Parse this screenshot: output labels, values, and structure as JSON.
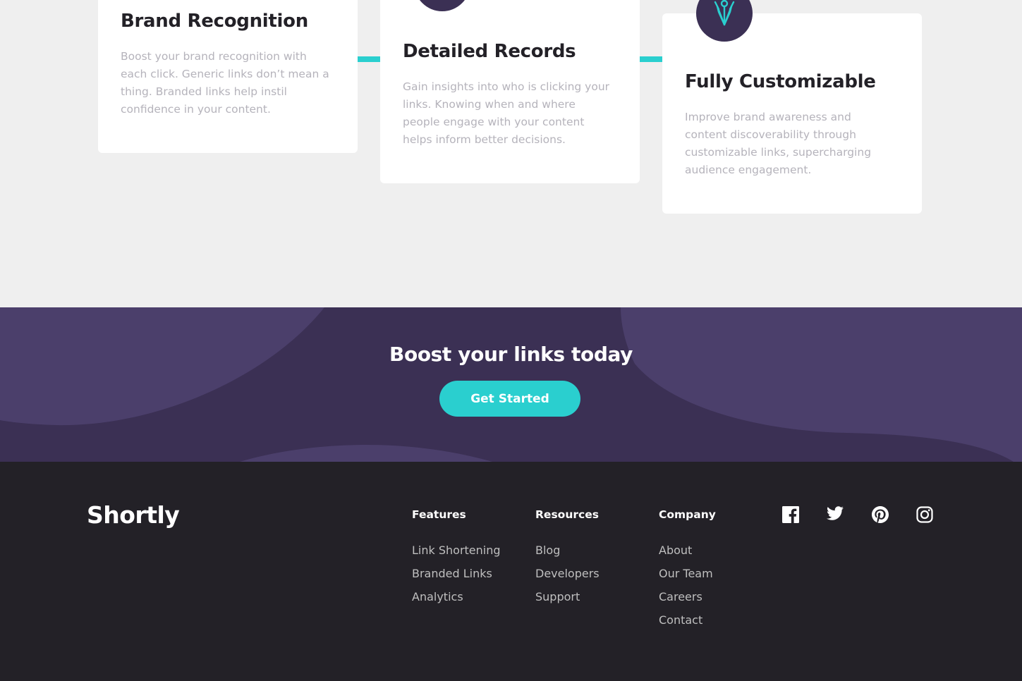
{
  "features": {
    "cards": [
      {
        "title": "Brand Recognition",
        "text": "Boost your brand recognition with each click. Generic links don’t mean a thing. Branded links help instil confidence in your content.",
        "icon": "brand-recognition-icon"
      },
      {
        "title": "Detailed Records",
        "text": "Gain insights into who is clicking your links. Knowing when and where people engage with your content helps inform better decisions.",
        "icon": "detailed-records-icon"
      },
      {
        "title": "Fully Customizable",
        "text": "Improve brand awareness and content discoverability through customizable links, supercharging audience engagement.",
        "icon": "fully-customizable-icon"
      }
    ]
  },
  "boost": {
    "heading": "Boost your links today",
    "button_label": "Get Started"
  },
  "footer": {
    "logo": "Shortly",
    "columns": [
      {
        "heading": "Features",
        "links": [
          "Link Shortening",
          "Branded Links",
          "Analytics"
        ]
      },
      {
        "heading": "Resources",
        "links": [
          "Blog",
          "Developers",
          "Support"
        ]
      },
      {
        "heading": "Company",
        "links": [
          "About",
          "Our Team",
          "Careers",
          "Contact"
        ]
      }
    ],
    "social": [
      "facebook-icon",
      "twitter-icon",
      "pinterest-icon",
      "instagram-icon"
    ]
  },
  "colors": {
    "cyan": "#2acfcf",
    "dark_violet": "#3b3054",
    "very_dark_violet": "#232127",
    "grayish_violet": "#b5b3bb",
    "background": "#efefef"
  }
}
